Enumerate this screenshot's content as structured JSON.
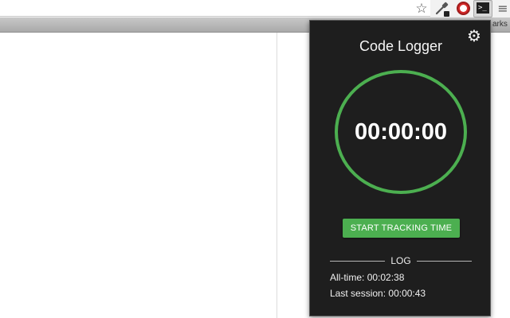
{
  "browser": {
    "bookmarks_label": "arks",
    "icons": {
      "star": "star-icon",
      "eyedropper": "eyedropper-extension-icon",
      "record": "record-extension-icon",
      "terminal": "terminal-extension-icon",
      "terminal_glyph": ">_",
      "menu": "hamburger-menu-icon"
    }
  },
  "popup": {
    "title": "Code Logger",
    "settings_icon": "gear-icon",
    "timer": "00:00:00",
    "start_button_label": "START TRACKING TIME",
    "log": {
      "heading": "LOG",
      "all_time_label": "All-time:",
      "all_time_value": "00:02:38",
      "last_session_label": "Last session:",
      "last_session_value": "00:00:43"
    }
  },
  "colors": {
    "accent": "#4caf50",
    "popup_background": "#1e1e1e",
    "record_red": "#d42a2a"
  }
}
